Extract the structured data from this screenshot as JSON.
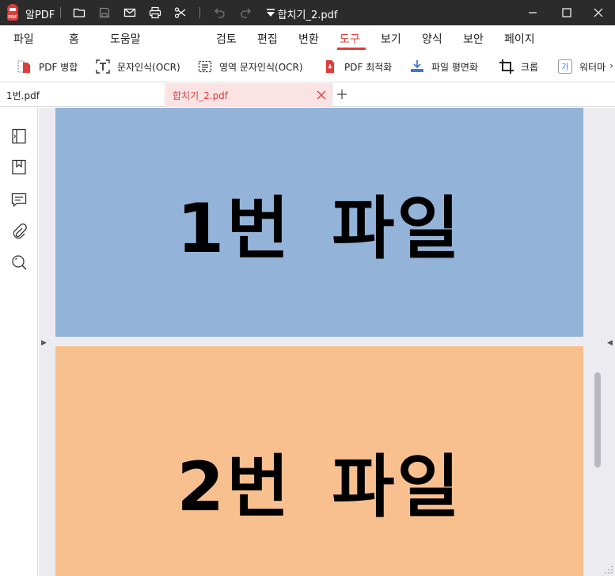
{
  "app": {
    "name": "알PDF",
    "document_title": "합치기_2.pdf"
  },
  "menu": {
    "items": [
      "파일",
      "홈",
      "도움말",
      "검토",
      "편집",
      "변환",
      "도구",
      "보기",
      "양식",
      "보안",
      "페이지"
    ],
    "active": "도구"
  },
  "toolbar": {
    "tools": [
      {
        "label": "PDF 병합",
        "icon": "merge-pdf-icon"
      },
      {
        "label": "문자인식(OCR)",
        "icon": "text-ocr-icon"
      },
      {
        "label": "영역 문자인식(OCR)",
        "icon": "area-ocr-icon"
      },
      {
        "label": "PDF 최적화",
        "icon": "optimize-pdf-icon"
      },
      {
        "label": "파일 평면화",
        "icon": "flatten-icon"
      },
      {
        "label": "크롭",
        "icon": "crop-icon"
      },
      {
        "label": "워터마",
        "icon": "watermark-icon"
      }
    ],
    "more": "›"
  },
  "tabs": [
    {
      "label": "1번.pdf",
      "active": false
    },
    {
      "label": "합치기_2.pdf",
      "active": true
    }
  ],
  "pages": [
    {
      "text": "1번 파일",
      "color": "#94b3d8"
    },
    {
      "text": "2번 파일",
      "color": "#f8c08f"
    }
  ],
  "colors": {
    "accent": "#e03c3c",
    "titlebar": "#2b2b2b",
    "active_tab_bg": "#fbe3e3"
  }
}
